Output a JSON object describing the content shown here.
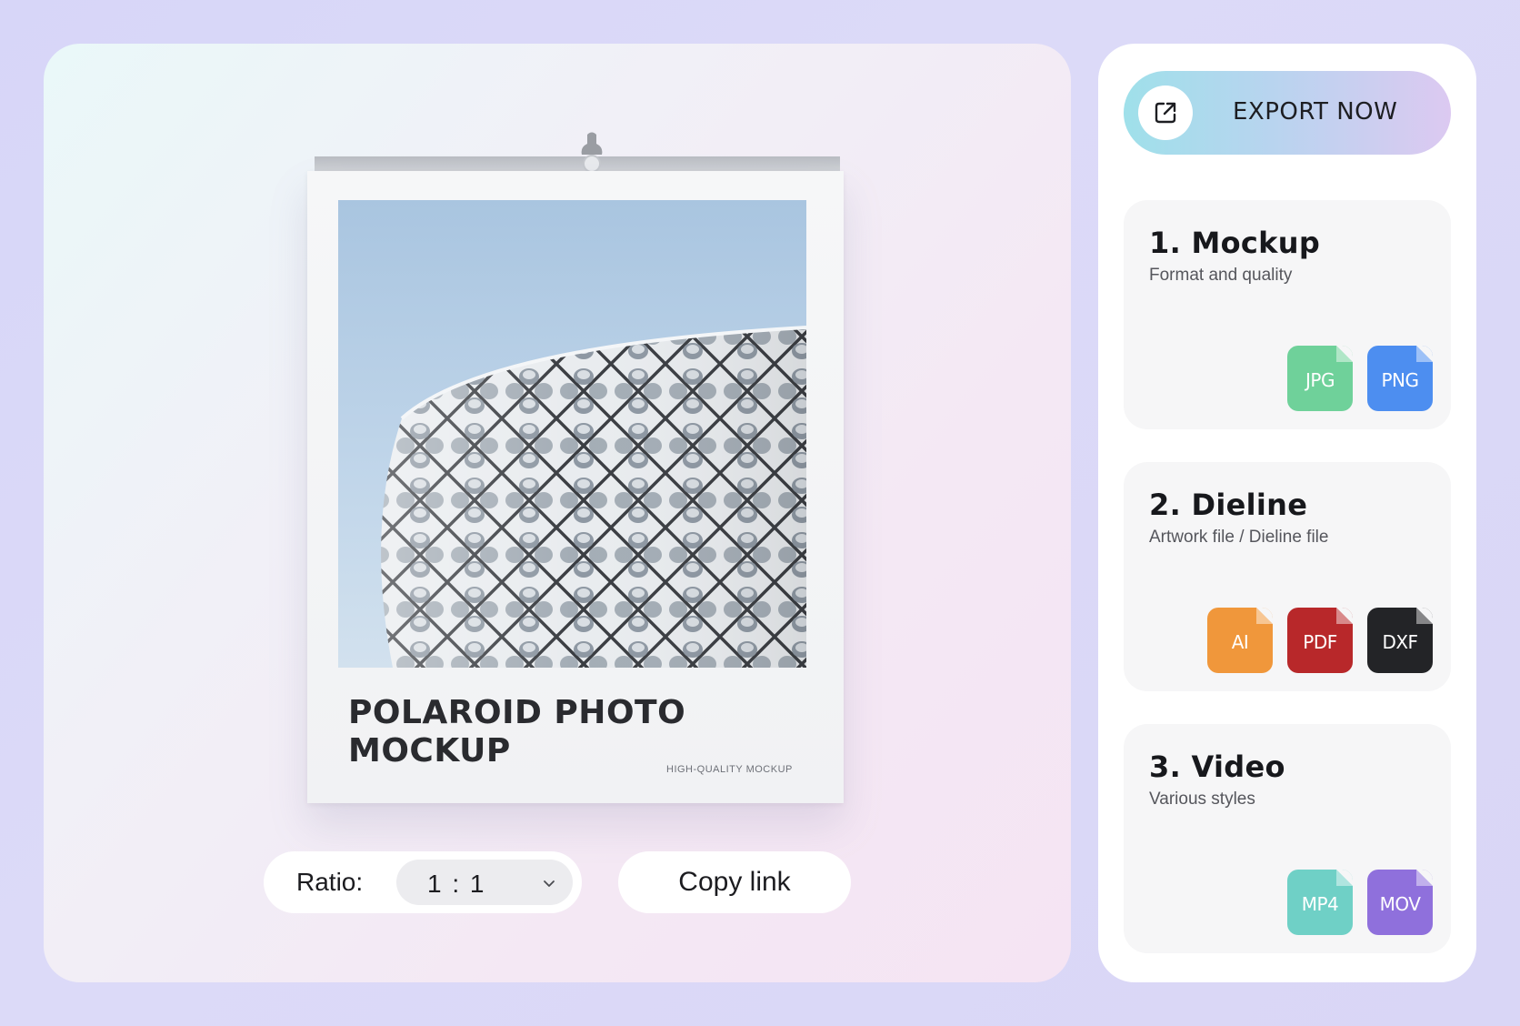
{
  "preview": {
    "polaroid_title": "POLAROID PHOTO MOCKUP",
    "polaroid_subtitle": "HIGH-QUALITY MOCKUP",
    "ratio_label": "Ratio:",
    "ratio_value": "1 : 1",
    "copy_link_label": "Copy link"
  },
  "export": {
    "button_label": "EXPORT NOW",
    "icon": "external-link-icon"
  },
  "sections": [
    {
      "title": "1.  Mockup",
      "subtitle": "Format and quality",
      "files": [
        {
          "label": "JPG",
          "color": "#6fd19a"
        },
        {
          "label": "PNG",
          "color": "#4d8ef0"
        }
      ]
    },
    {
      "title": "2. Dieline",
      "subtitle": "Artwork file / Dieline file",
      "files": [
        {
          "label": "AI",
          "color": "#f0973b"
        },
        {
          "label": "PDF",
          "color": "#b8282a"
        },
        {
          "label": "DXF",
          "color": "#232427"
        }
      ]
    },
    {
      "title": "3. Video",
      "subtitle": "Various styles",
      "files": [
        {
          "label": "MP4",
          "color": "#6fd0c6"
        },
        {
          "label": "MOV",
          "color": "#8f70dc"
        }
      ]
    }
  ]
}
